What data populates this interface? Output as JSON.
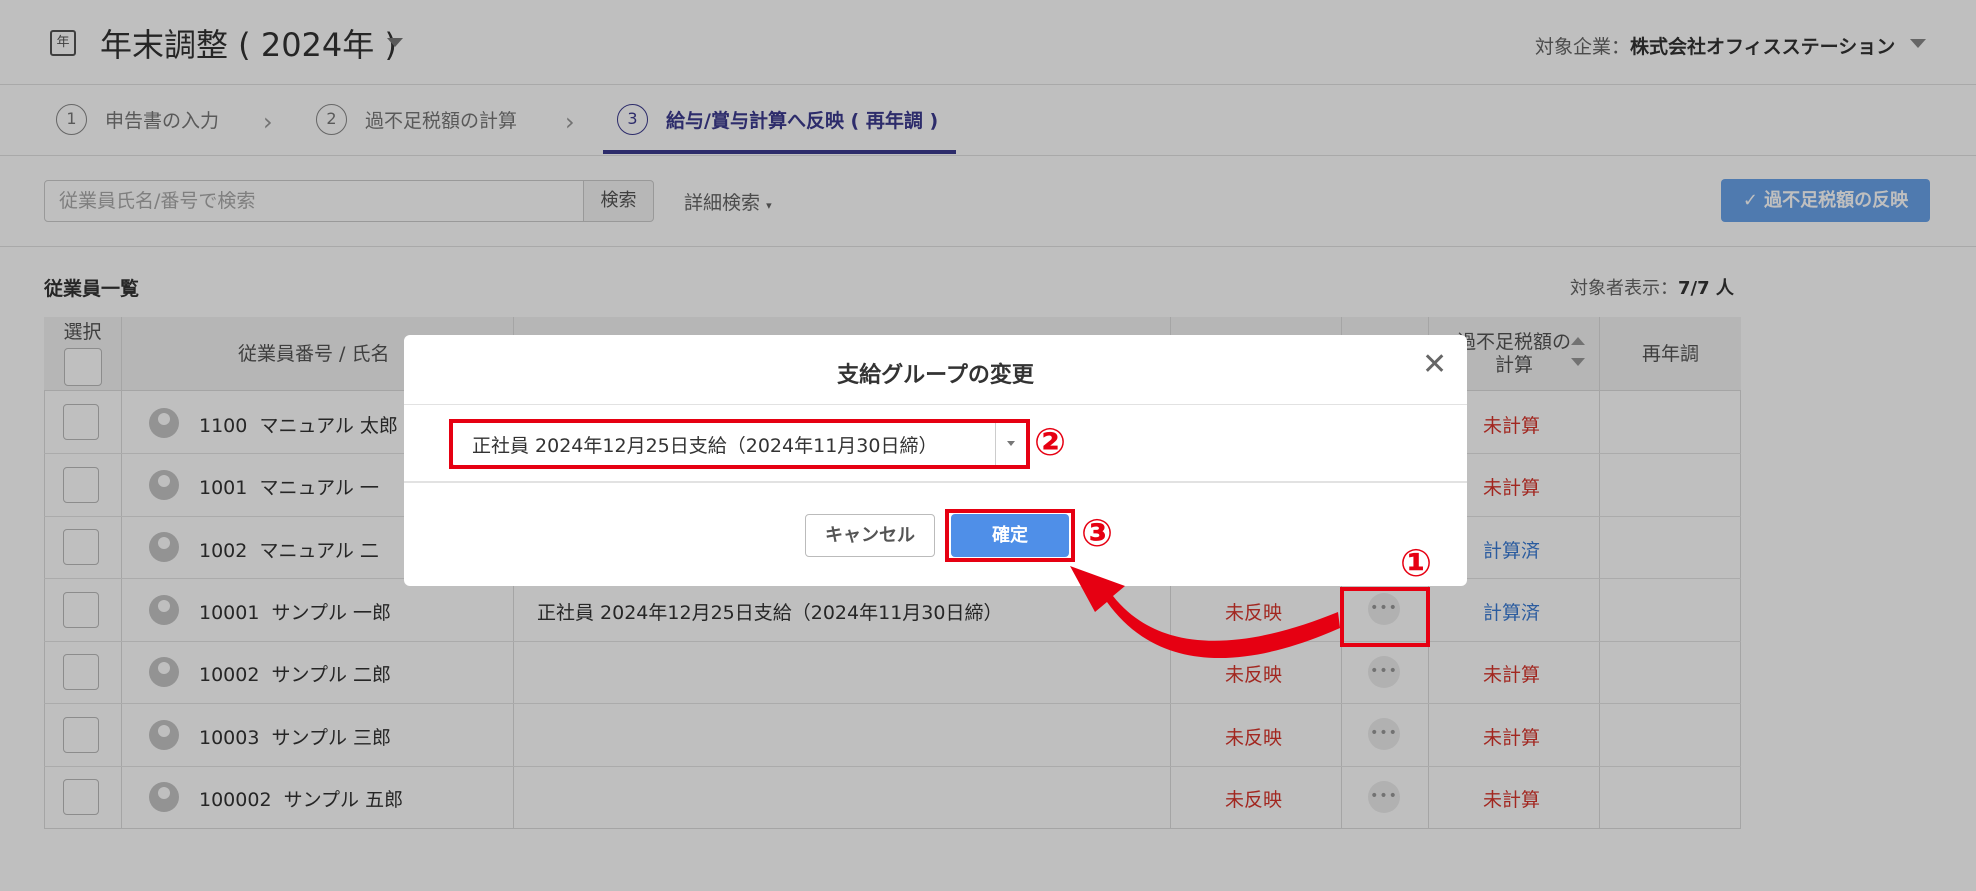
{
  "header": {
    "title": "年末調整 ( 2024年 )",
    "title_icon_glyph": "年",
    "company_label": "対象企業：",
    "company_name": "株式会社オフィスステーション"
  },
  "steps": [
    {
      "num": "1",
      "label": "申告書の入力"
    },
    {
      "num": "2",
      "label": "過不足税額の計算"
    },
    {
      "num": "3",
      "label": "給与/賞与計算へ反映 ( 再年調 )"
    }
  ],
  "toolbar": {
    "search_placeholder": "従業員氏名/番号で検索",
    "search_button": "検索",
    "advanced_search": "詳細検索",
    "reflect_button": "✓ 過不足税額の反映"
  },
  "list": {
    "title": "従業員一覧",
    "count_label": "対象者表示：",
    "count_value": "7/7 人"
  },
  "table": {
    "headers": {
      "select": "選択",
      "employee": "従業員番号 / 氏名",
      "reflect": "過不足税額の",
      "calc_line1": "過不足税額の",
      "calc_line2": "計算",
      "readjust": "再年調"
    },
    "rows": [
      {
        "id": "1100",
        "name": "マニュアル 太郎",
        "group": "",
        "reflect": "",
        "calc": "未計算",
        "calc_status": "red"
      },
      {
        "id": "1001",
        "name": "マニュアル 一",
        "group": "",
        "reflect": "",
        "calc": "未計算",
        "calc_status": "red"
      },
      {
        "id": "1002",
        "name": "マニュアル 二",
        "group": "",
        "reflect": "",
        "calc": "計算済",
        "calc_status": "blue"
      },
      {
        "id": "10001",
        "name": "サンプル 一郎",
        "group": "正社員 2024年12月25日支給（2024年11月30日締）",
        "reflect": "未反映",
        "calc": "計算済",
        "calc_status": "blue"
      },
      {
        "id": "10002",
        "name": "サンプル 二郎",
        "group": "",
        "reflect": "未反映",
        "calc": "未計算",
        "calc_status": "red"
      },
      {
        "id": "10003",
        "name": "サンプル 三郎",
        "group": "",
        "reflect": "未反映",
        "calc": "未計算",
        "calc_status": "red"
      },
      {
        "id": "100002",
        "name": "サンプル 五郎",
        "group": "",
        "reflect": "未反映",
        "calc": "未計算",
        "calc_status": "red"
      }
    ],
    "more_glyph": "•••"
  },
  "modal": {
    "title": "支給グループの変更",
    "close_glyph": "✕",
    "select_value": "正社員 2024年12月25日支給（2024年11月30日締）",
    "cancel": "キャンセル",
    "confirm": "確定"
  },
  "annotations": {
    "num1": "①",
    "num2": "②",
    "num3": "③",
    "color": "#e60012"
  },
  "colors": {
    "accent": "#3d3b8f",
    "primary_button": "#4f8fe8",
    "status_red": "#d9342b",
    "status_blue": "#3a7bd5"
  }
}
